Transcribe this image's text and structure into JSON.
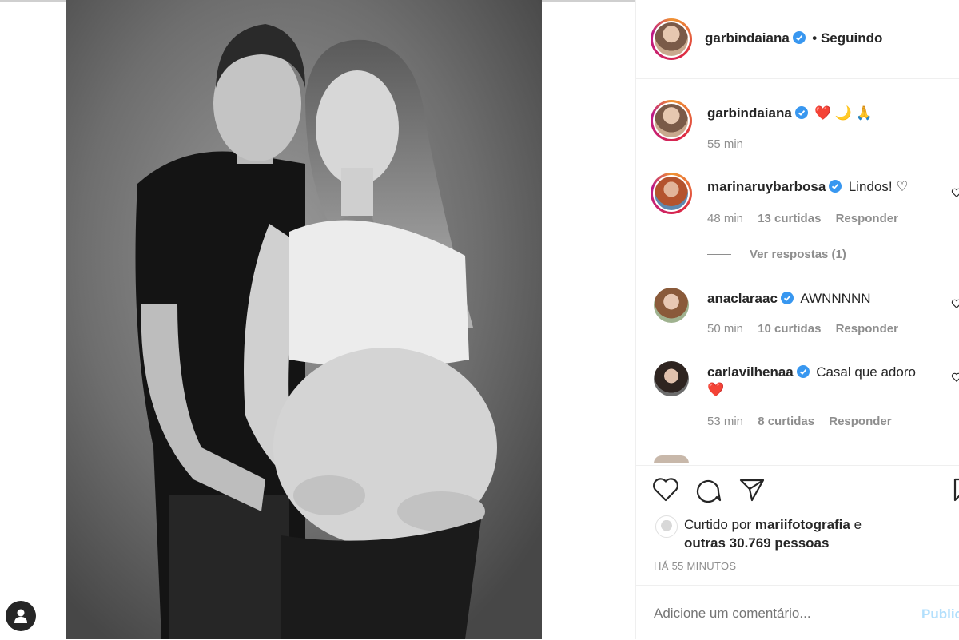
{
  "post": {
    "author": "garbindaiana",
    "follow_status": "• Seguindo",
    "caption_emojis": [
      "❤️",
      "🌙",
      "🙏"
    ],
    "caption_time": "55 min"
  },
  "comments": [
    {
      "user": "marinaruybarbosa",
      "text": "Lindos! ♡",
      "time": "48 min",
      "likes": "13 curtidas",
      "reply": "Responder"
    },
    {
      "user": "anaclaraac",
      "text": "AWNNNNN",
      "time": "50 min",
      "likes": "10 curtidas",
      "reply": "Responder"
    },
    {
      "user": "carlavilhenaa",
      "text": "Casal que adoro",
      "text2": "❤️",
      "time": "53 min",
      "likes": "8 curtidas",
      "reply": "Responder"
    }
  ],
  "view_replies": "Ver respostas (1)",
  "likes": {
    "prefix": "Curtido por",
    "user": "mariifotografia",
    "suffix": "e",
    "others": "outras 30.769 pessoas"
  },
  "timestamp": "HÁ 55 MINUTOS",
  "add_comment": {
    "placeholder": "Adicione um comentário...",
    "publish": "Publicar"
  },
  "icons": {
    "verified": "verified-badge-icon",
    "like": "heart-icon",
    "comment": "comment-icon",
    "share": "send-icon",
    "save": "bookmark-icon",
    "user": "user-icon"
  },
  "colors": {
    "verified": "#3897f0",
    "link": "#b2dffc",
    "muted": "#8e8e8e"
  }
}
